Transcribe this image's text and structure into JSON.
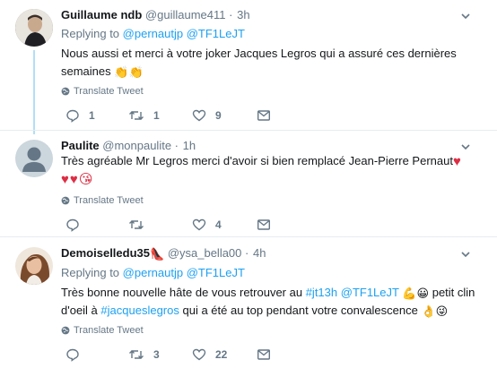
{
  "tweets": [
    {
      "name": "Guillaume ndb",
      "handle": "@guillaume411",
      "dot": "·",
      "time": "3h",
      "replying_prefix": "Replying to",
      "reply_to_1": "@pernautjp",
      "reply_to_2": "@TF1LeJT",
      "text_line_1": "Nous aussi et merci à votre joker Jacques Legros qui a assuré ces dernières",
      "text_line_2": "semaines",
      "emojis": "👏👏",
      "translate": "Translate Tweet",
      "replies": "1",
      "retweets": "1",
      "likes": "9"
    },
    {
      "name": "Paulite",
      "handle": "@monpaulite",
      "dot": "·",
      "time": "1h",
      "text_line_1": "Très agréable Mr Legros merci d'avoir si bien remplacé  Jean-Pierre Pernaut",
      "emojis_inline": "♥",
      "emojis_line_2": "♥♥😘",
      "translate": "Translate Tweet",
      "replies": "",
      "retweets": "",
      "likes": "4"
    },
    {
      "name": "Demoiselledu35",
      "name_emoji": "👠",
      "handle": "@ysa_bella00",
      "dot": "·",
      "time": "4h",
      "replying_prefix": "Replying to",
      "reply_to_1": "@pernautjp",
      "reply_to_2": "@TF1LeJT",
      "text_part_1": "Très bonne nouvelle hâte de vous retrouver au",
      "hashtag_1": "#jt13h",
      "mention_1": "@TF1LeJT",
      "emojis_1": "💪😀",
      "text_part_2": " petit clin",
      "text_part_3": "d'oeil à",
      "hashtag_2": "#jacqueslegros",
      "text_part_4": "qui a été au top pendant votre convalescence",
      "emojis_2": "👌😜",
      "translate": "Translate Tweet",
      "replies": "",
      "retweets": "3",
      "likes": "22"
    }
  ],
  "icons": {
    "reply": "reply-icon",
    "retweet": "retweet-icon",
    "like": "heart-icon",
    "dm": "envelope-icon",
    "translate": "globe-icon",
    "caret": "chevron-down-icon"
  },
  "colors": {
    "link": "#1da1f2",
    "muted": "#657786",
    "thread_line": "#b2dff7",
    "separator": "#e6ecf0",
    "heart_emoji": "#dd2e44"
  }
}
